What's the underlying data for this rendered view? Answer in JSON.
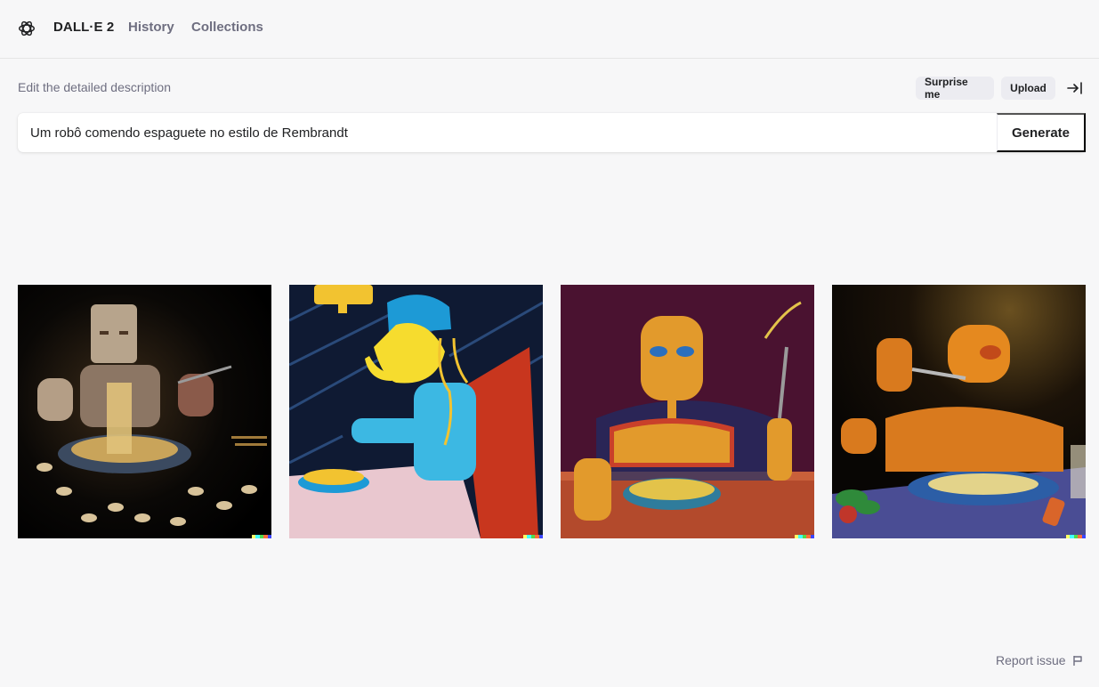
{
  "header": {
    "brand": "DALL·E 2",
    "nav": [
      {
        "label": "History"
      },
      {
        "label": "Collections"
      }
    ],
    "logo_icon": "openai-logo-icon"
  },
  "editor": {
    "description_label": "Edit the detailed description",
    "surprise_label": "Surprise me",
    "upload_label": "Upload",
    "collapse_icon": "collapse-right-icon",
    "prompt_value": "Um robô comendo espaguete no estilo de Rembrandt",
    "generate_label": "Generate"
  },
  "results": {
    "images": [
      {
        "subject": "photographic robot eating noodles on dark background"
      },
      {
        "subject": "cartoon blue robot with yellow face eating spaghetti"
      },
      {
        "subject": "orange wooden robot holding fork over bowl"
      },
      {
        "subject": "orange robot at candlelit table eating spaghetti"
      }
    ],
    "signature_colors": [
      "#ffff66",
      "#42ffff",
      "#51da4c",
      "#ff6e3c",
      "#3c46ff"
    ]
  },
  "footer": {
    "report_label": "Report issue",
    "report_icon": "flag-icon"
  },
  "colors": {
    "background": "#f7f7f8",
    "text": "#202123",
    "muted": "#6e6e80",
    "chip": "#ececf1"
  }
}
